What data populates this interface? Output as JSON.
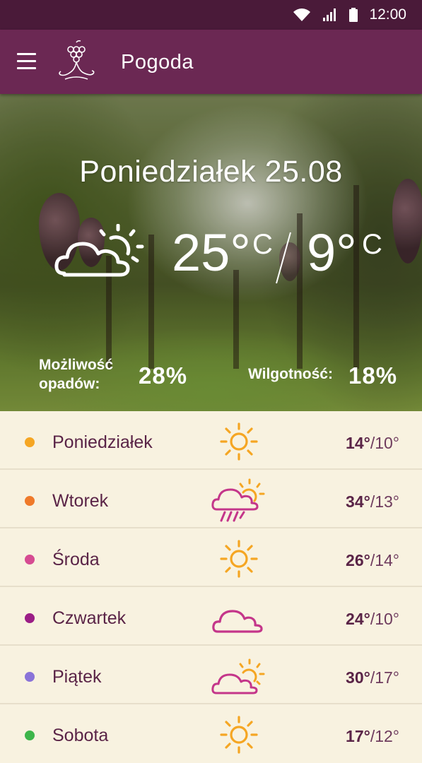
{
  "status_bar": {
    "time": "12:00",
    "icons": [
      "wifi-icon",
      "signal-icon",
      "battery-icon"
    ]
  },
  "app_bar": {
    "title": "Pogoda",
    "menu_icon": "hamburger-menu-icon",
    "logo": "grape-logo"
  },
  "hero": {
    "date": "Poniedziałek 25.08",
    "condition_icon": "partly-cloudy-icon",
    "temp_max": "25°",
    "temp_min": "9°",
    "unit": "C",
    "rain_label_line1": "Możliwość",
    "rain_label_line2": "opadów:",
    "rain_value": "28%",
    "humidity_label": "Wilgotność:",
    "humidity_value": "18%"
  },
  "forecast": [
    {
      "day": "Poniedziałek",
      "icon": "sun-icon",
      "high": "14°",
      "low": "/10°",
      "dot_color": "#f5a623"
    },
    {
      "day": "Wtorek",
      "icon": "rain-sun-icon",
      "high": "34°",
      "low": "/13°",
      "dot_color": "#ef7a2a"
    },
    {
      "day": "Środa",
      "icon": "sun-icon",
      "high": "26°",
      "low": "/14°",
      "dot_color": "#d64b92"
    },
    {
      "day": "Czwartek",
      "icon": "cloud-icon",
      "high": "24°",
      "low": "/10°",
      "dot_color": "#9b1e86"
    },
    {
      "day": "Piątek",
      "icon": "cloud-sun-icon",
      "high": "30°",
      "low": "/17°",
      "dot_color": "#8a73d8"
    },
    {
      "day": "Sobota",
      "icon": "sun-icon",
      "high": "17°",
      "low": "/12°",
      "dot_color": "#3db54a"
    }
  ],
  "colors": {
    "status_bar": "#4a1a39",
    "app_bar": "#6b2853",
    "list_background": "#f8f2e0",
    "sun": "#f5a623",
    "cloud": "#c4368a",
    "text": "#5a2447"
  }
}
